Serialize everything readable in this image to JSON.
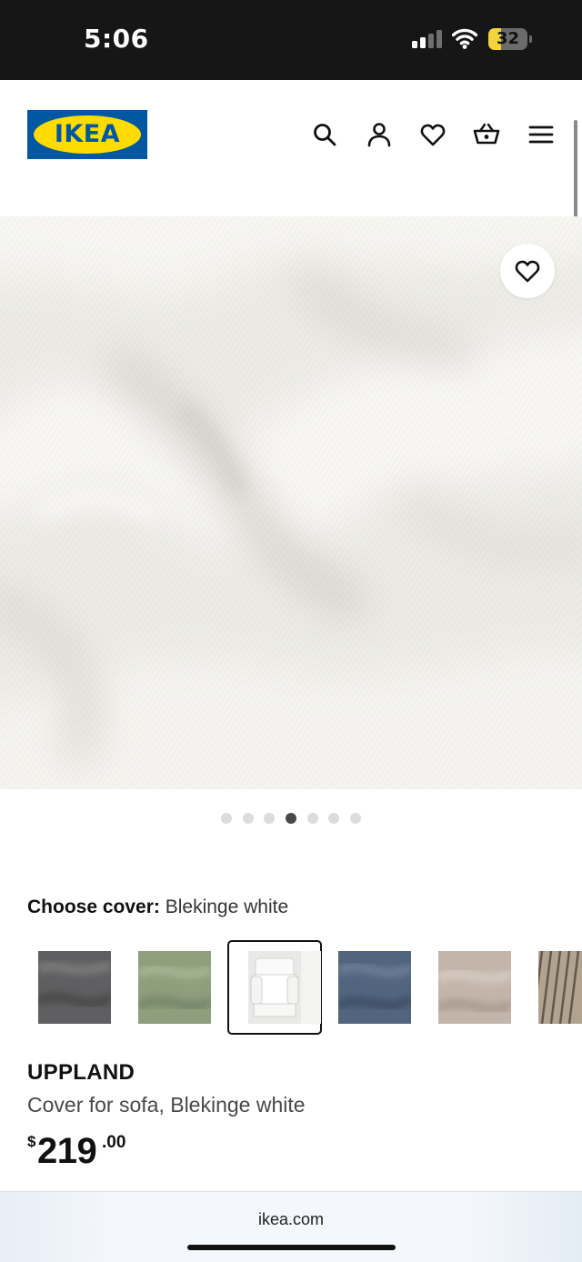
{
  "status_bar": {
    "time": "5:06",
    "battery_level": "32",
    "battery_percent": 32,
    "battery_color": "#f5d33c",
    "signal_bars_active": 2,
    "signal_bars_total": 4
  },
  "header": {
    "logo_text": "IKEA",
    "brand_colors": {
      "blue": "#0058a3",
      "yellow": "#ffdb00"
    },
    "icons": [
      "search-icon",
      "account-icon",
      "heart-icon",
      "shopping-bag-icon",
      "menu-icon"
    ]
  },
  "hero": {
    "image": "white fabric texture",
    "favorite_icon": "heart-icon"
  },
  "carousel": {
    "total_slides": 7,
    "active_index": 3
  },
  "cover": {
    "label": "Choose cover:",
    "selected": "Blekinge white",
    "swatches": [
      {
        "name": "dark grey fabric",
        "color": "#5f5f61"
      },
      {
        "name": "green fabric",
        "color": "#8f9e7c"
      },
      {
        "name": "Blekinge white sofa",
        "color": "#eeeeec",
        "selected": true
      },
      {
        "name": "blue fabric",
        "color": "#52657f"
      },
      {
        "name": "beige fabric",
        "color": "#c3b5aa"
      },
      {
        "name": "striped fabric",
        "color": "#a69682"
      }
    ]
  },
  "product": {
    "name": "UPPLAND",
    "description": "Cover for sofa, Blekinge white",
    "price_currency": "$",
    "price_integer": "219",
    "price_decimal": ".00"
  },
  "browser": {
    "url": "ikea.com"
  }
}
